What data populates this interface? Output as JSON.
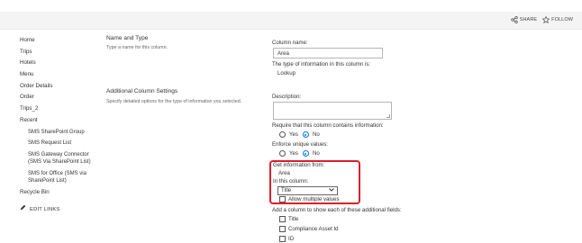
{
  "top_actions": {
    "share": "SHARE",
    "follow": "FOLLOW"
  },
  "nav": {
    "items": [
      "Home",
      "Trips",
      "Hotels",
      "Menu",
      "Order Details",
      "Order",
      "Trips_2",
      "Recent"
    ],
    "recent": [
      "SMS SharePoint Group",
      "SMS Request List",
      "SMS Gateway Connector (SMS Via SharePoint List)",
      "SMS for Office (SMS via SharePoint List)"
    ],
    "recycle_bin": "Recycle Bin",
    "edit_links": "EDIT LINKS"
  },
  "sections": {
    "name_type": {
      "title": "Name and Type",
      "desc": "Type a name for this column."
    },
    "additional": {
      "title": "Additional Column Settings",
      "desc": "Specify detailed options for the type of information you selected."
    }
  },
  "form": {
    "column_name_label": "Column name:",
    "column_name_value": "Area",
    "type_label": "The type of information in this column is:",
    "type_value": "Lookup",
    "description_label": "Description:",
    "require_label": "Require that this column contains information:",
    "enforce_label": "Enforce unique values:",
    "yes": "Yes",
    "no": "No",
    "get_info_label": "Get information from:",
    "get_info_value": "Area",
    "in_column_label": "In this column:",
    "in_column_value": "Title",
    "allow_multiple": "Allow multiple values",
    "additional_fields_label": "Add a column to show each of these additional fields:",
    "fields": [
      "Title",
      "Compliance Asset Id",
      "ID"
    ]
  }
}
